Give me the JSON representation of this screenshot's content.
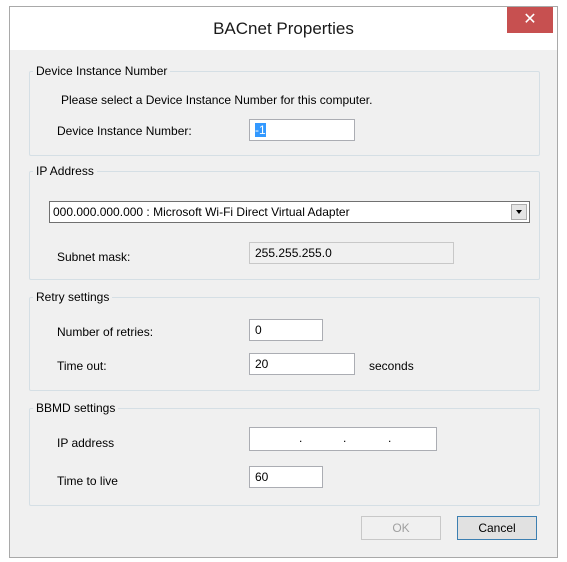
{
  "window": {
    "title": "BACnet Properties",
    "close_glyph": "✕"
  },
  "device_group": {
    "legend": "Device Instance Number",
    "instruction": "Please select a Device Instance Number for this computer.",
    "field_label": "Device Instance Number:",
    "field_value": "-1"
  },
  "ip_group": {
    "legend": "IP Address",
    "adapter_selected": "000.000.000.000 : Microsoft Wi-Fi Direct Virtual Adapter",
    "subnet_label": "Subnet mask:",
    "subnet_value": "255.255.255.0"
  },
  "retry_group": {
    "legend": "Retry settings",
    "retries_label": "Number of retries:",
    "retries_value": "0",
    "timeout_label": "Time out:",
    "timeout_value": "20",
    "timeout_unit": "seconds"
  },
  "bbmd_group": {
    "legend": "BBMD settings",
    "ip_label": "IP address",
    "ip_dots": [
      ".",
      ".",
      "."
    ],
    "ttl_label": "Time to live",
    "ttl_value": "60"
  },
  "buttons": {
    "ok": "OK",
    "cancel": "Cancel"
  },
  "colors": {
    "close_bg": "#c75050",
    "selection": "#3399ff",
    "dialog_bg": "#f0f0f0"
  }
}
